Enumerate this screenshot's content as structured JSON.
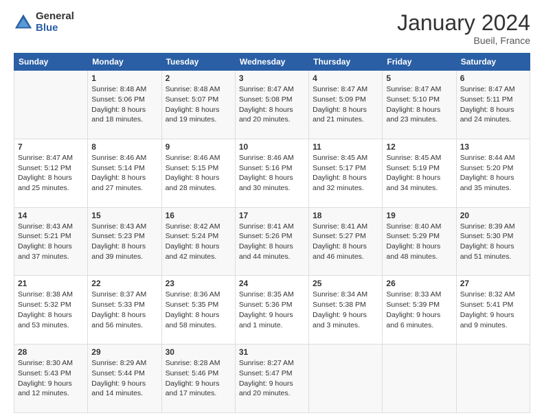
{
  "header": {
    "logo_general": "General",
    "logo_blue": "Blue",
    "title": "January 2024",
    "location": "Bueil, France"
  },
  "columns": [
    "Sunday",
    "Monday",
    "Tuesday",
    "Wednesday",
    "Thursday",
    "Friday",
    "Saturday"
  ],
  "weeks": [
    [
      {
        "day": "",
        "lines": []
      },
      {
        "day": "1",
        "lines": [
          "Sunrise: 8:48 AM",
          "Sunset: 5:06 PM",
          "Daylight: 8 hours",
          "and 18 minutes."
        ]
      },
      {
        "day": "2",
        "lines": [
          "Sunrise: 8:48 AM",
          "Sunset: 5:07 PM",
          "Daylight: 8 hours",
          "and 19 minutes."
        ]
      },
      {
        "day": "3",
        "lines": [
          "Sunrise: 8:47 AM",
          "Sunset: 5:08 PM",
          "Daylight: 8 hours",
          "and 20 minutes."
        ]
      },
      {
        "day": "4",
        "lines": [
          "Sunrise: 8:47 AM",
          "Sunset: 5:09 PM",
          "Daylight: 8 hours",
          "and 21 minutes."
        ]
      },
      {
        "day": "5",
        "lines": [
          "Sunrise: 8:47 AM",
          "Sunset: 5:10 PM",
          "Daylight: 8 hours",
          "and 23 minutes."
        ]
      },
      {
        "day": "6",
        "lines": [
          "Sunrise: 8:47 AM",
          "Sunset: 5:11 PM",
          "Daylight: 8 hours",
          "and 24 minutes."
        ]
      }
    ],
    [
      {
        "day": "7",
        "lines": [
          "Sunrise: 8:47 AM",
          "Sunset: 5:12 PM",
          "Daylight: 8 hours",
          "and 25 minutes."
        ]
      },
      {
        "day": "8",
        "lines": [
          "Sunrise: 8:46 AM",
          "Sunset: 5:14 PM",
          "Daylight: 8 hours",
          "and 27 minutes."
        ]
      },
      {
        "day": "9",
        "lines": [
          "Sunrise: 8:46 AM",
          "Sunset: 5:15 PM",
          "Daylight: 8 hours",
          "and 28 minutes."
        ]
      },
      {
        "day": "10",
        "lines": [
          "Sunrise: 8:46 AM",
          "Sunset: 5:16 PM",
          "Daylight: 8 hours",
          "and 30 minutes."
        ]
      },
      {
        "day": "11",
        "lines": [
          "Sunrise: 8:45 AM",
          "Sunset: 5:17 PM",
          "Daylight: 8 hours",
          "and 32 minutes."
        ]
      },
      {
        "day": "12",
        "lines": [
          "Sunrise: 8:45 AM",
          "Sunset: 5:19 PM",
          "Daylight: 8 hours",
          "and 34 minutes."
        ]
      },
      {
        "day": "13",
        "lines": [
          "Sunrise: 8:44 AM",
          "Sunset: 5:20 PM",
          "Daylight: 8 hours",
          "and 35 minutes."
        ]
      }
    ],
    [
      {
        "day": "14",
        "lines": [
          "Sunrise: 8:43 AM",
          "Sunset: 5:21 PM",
          "Daylight: 8 hours",
          "and 37 minutes."
        ]
      },
      {
        "day": "15",
        "lines": [
          "Sunrise: 8:43 AM",
          "Sunset: 5:23 PM",
          "Daylight: 8 hours",
          "and 39 minutes."
        ]
      },
      {
        "day": "16",
        "lines": [
          "Sunrise: 8:42 AM",
          "Sunset: 5:24 PM",
          "Daylight: 8 hours",
          "and 42 minutes."
        ]
      },
      {
        "day": "17",
        "lines": [
          "Sunrise: 8:41 AM",
          "Sunset: 5:26 PM",
          "Daylight: 8 hours",
          "and 44 minutes."
        ]
      },
      {
        "day": "18",
        "lines": [
          "Sunrise: 8:41 AM",
          "Sunset: 5:27 PM",
          "Daylight: 8 hours",
          "and 46 minutes."
        ]
      },
      {
        "day": "19",
        "lines": [
          "Sunrise: 8:40 AM",
          "Sunset: 5:29 PM",
          "Daylight: 8 hours",
          "and 48 minutes."
        ]
      },
      {
        "day": "20",
        "lines": [
          "Sunrise: 8:39 AM",
          "Sunset: 5:30 PM",
          "Daylight: 8 hours",
          "and 51 minutes."
        ]
      }
    ],
    [
      {
        "day": "21",
        "lines": [
          "Sunrise: 8:38 AM",
          "Sunset: 5:32 PM",
          "Daylight: 8 hours",
          "and 53 minutes."
        ]
      },
      {
        "day": "22",
        "lines": [
          "Sunrise: 8:37 AM",
          "Sunset: 5:33 PM",
          "Daylight: 8 hours",
          "and 56 minutes."
        ]
      },
      {
        "day": "23",
        "lines": [
          "Sunrise: 8:36 AM",
          "Sunset: 5:35 PM",
          "Daylight: 8 hours",
          "and 58 minutes."
        ]
      },
      {
        "day": "24",
        "lines": [
          "Sunrise: 8:35 AM",
          "Sunset: 5:36 PM",
          "Daylight: 9 hours",
          "and 1 minute."
        ]
      },
      {
        "day": "25",
        "lines": [
          "Sunrise: 8:34 AM",
          "Sunset: 5:38 PM",
          "Daylight: 9 hours",
          "and 3 minutes."
        ]
      },
      {
        "day": "26",
        "lines": [
          "Sunrise: 8:33 AM",
          "Sunset: 5:39 PM",
          "Daylight: 9 hours",
          "and 6 minutes."
        ]
      },
      {
        "day": "27",
        "lines": [
          "Sunrise: 8:32 AM",
          "Sunset: 5:41 PM",
          "Daylight: 9 hours",
          "and 9 minutes."
        ]
      }
    ],
    [
      {
        "day": "28",
        "lines": [
          "Sunrise: 8:30 AM",
          "Sunset: 5:43 PM",
          "Daylight: 9 hours",
          "and 12 minutes."
        ]
      },
      {
        "day": "29",
        "lines": [
          "Sunrise: 8:29 AM",
          "Sunset: 5:44 PM",
          "Daylight: 9 hours",
          "and 14 minutes."
        ]
      },
      {
        "day": "30",
        "lines": [
          "Sunrise: 8:28 AM",
          "Sunset: 5:46 PM",
          "Daylight: 9 hours",
          "and 17 minutes."
        ]
      },
      {
        "day": "31",
        "lines": [
          "Sunrise: 8:27 AM",
          "Sunset: 5:47 PM",
          "Daylight: 9 hours",
          "and 20 minutes."
        ]
      },
      {
        "day": "",
        "lines": []
      },
      {
        "day": "",
        "lines": []
      },
      {
        "day": "",
        "lines": []
      }
    ]
  ]
}
